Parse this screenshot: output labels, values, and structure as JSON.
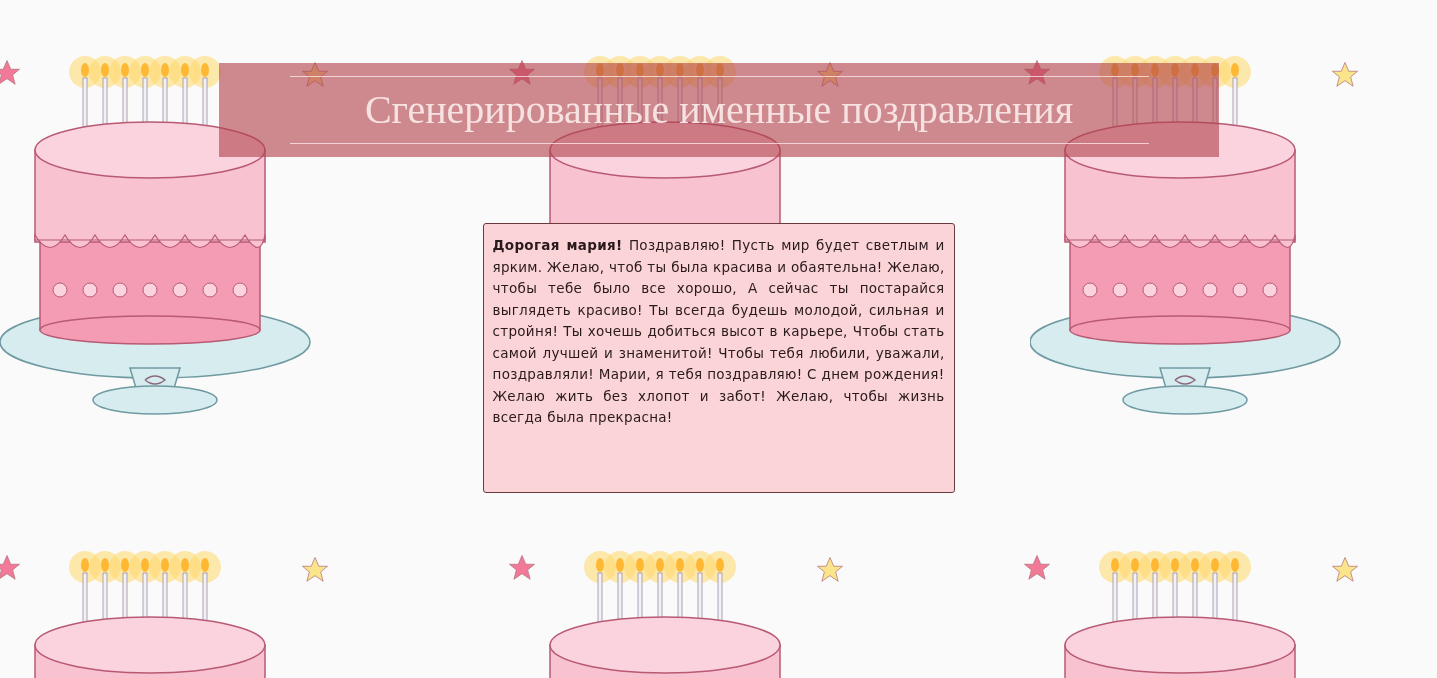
{
  "header": {
    "title": "Сгенерированные именные поздравления"
  },
  "greeting": {
    "salutation": "Дорогая мария!",
    "text": "Поздравляю! Пусть мир будет светлым и ярким. Желаю, чтоб ты была красива и обаятельна! Желаю, чтобы тебе было все хорошо, А сейчас ты постарайся выглядеть красиво! Ты всегда будешь молодой, сильная и стройня! Ты хочешь добиться высот в карьере, Чтобы стать самой лучшей и знаменитой! Чтобы тебя любили, уважали, поздравляли! Марии, я тебя поздравляю! С днем рождения! Желаю жить без хлопот и забот! Желаю, чтобы жизнь всегда была прекрасна!"
  }
}
